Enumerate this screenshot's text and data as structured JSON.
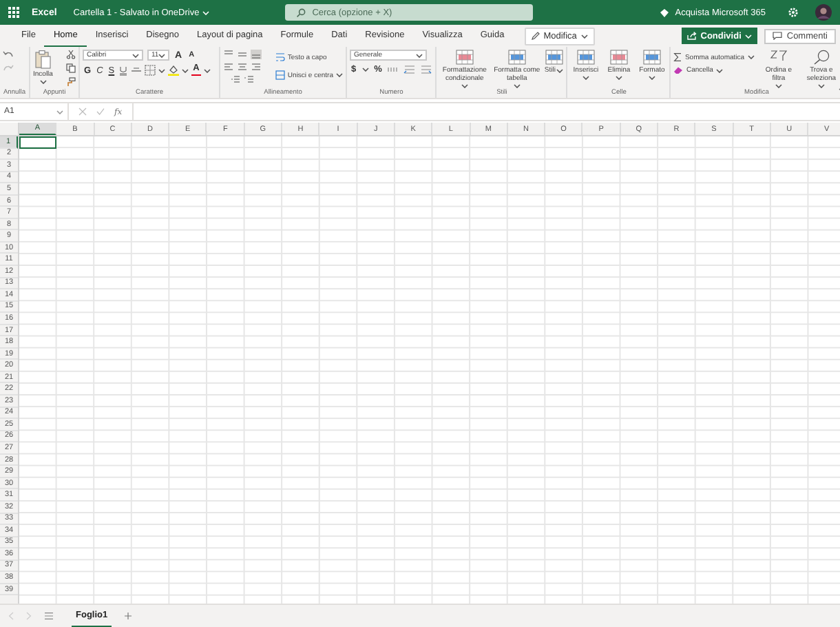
{
  "title_bar": {
    "app": "Excel",
    "document": "Cartella 1 - Salvato in OneDrive",
    "search_placeholder": "Cerca (opzione + X)",
    "buy": "Acquista Microsoft 365"
  },
  "tabs": [
    {
      "label": "File",
      "selected": false
    },
    {
      "label": "Home",
      "selected": true
    },
    {
      "label": "Inserisci",
      "selected": false
    },
    {
      "label": "Disegno",
      "selected": false
    },
    {
      "label": "Layout di pagina",
      "selected": false
    },
    {
      "label": "Formule",
      "selected": false
    },
    {
      "label": "Dati",
      "selected": false
    },
    {
      "label": "Revisione",
      "selected": false
    },
    {
      "label": "Visualizza",
      "selected": false
    },
    {
      "label": "Guida",
      "selected": false
    }
  ],
  "mode_button": "Modifica",
  "share_button": "Condividi",
  "comments_button": "Commenti",
  "ribbon": [
    {
      "kind": "undo",
      "label": "Annulla"
    },
    {
      "kind": "clipboard",
      "label": "Appunti",
      "paste": "Incolla"
    },
    {
      "kind": "font",
      "label": "Carattere",
      "font": "Calibri",
      "size": "11",
      "grow": "A",
      "shrink": "A",
      "bold": "G",
      "italic": "C",
      "underline": "S",
      "font_color": "A"
    },
    {
      "kind": "alignment",
      "label": "Allineamento",
      "wrap": "Testo a capo",
      "merge": "Unisci e centra"
    },
    {
      "kind": "number",
      "label": "Numero",
      "format": "Generale",
      "currency": "$",
      "percent": "%"
    },
    {
      "kind": "big",
      "label": "Stili",
      "buttons": [
        "Formattazione condizionale",
        "Formatta come tabella",
        "Stili"
      ]
    },
    {
      "kind": "big",
      "label": "Celle",
      "buttons": [
        "Inserisci",
        "Elimina",
        "Formato"
      ]
    },
    {
      "kind": "editing",
      "label": "Modifica",
      "autosum": "Somma automatica",
      "clear": "Cancella",
      "buttons": [
        "Ordina e filtra",
        "Trova e seleziona"
      ]
    }
  ],
  "name_box": "A1",
  "fx": "fx",
  "columns": [
    {
      "label": "A",
      "selected": true
    },
    {
      "label": "B",
      "selected": false
    },
    {
      "label": "C",
      "selected": false
    },
    {
      "label": "D",
      "selected": false
    },
    {
      "label": "E",
      "selected": false
    },
    {
      "label": "F",
      "selected": false
    },
    {
      "label": "G",
      "selected": false
    },
    {
      "label": "H",
      "selected": false
    },
    {
      "label": "I",
      "selected": false
    },
    {
      "label": "J",
      "selected": false
    },
    {
      "label": "K",
      "selected": false
    },
    {
      "label": "L",
      "selected": false
    },
    {
      "label": "M",
      "selected": false
    },
    {
      "label": "N",
      "selected": false
    },
    {
      "label": "O",
      "selected": false
    },
    {
      "label": "P",
      "selected": false
    },
    {
      "label": "Q",
      "selected": false
    },
    {
      "label": "R",
      "selected": false
    },
    {
      "label": "S",
      "selected": false
    },
    {
      "label": "T",
      "selected": false
    },
    {
      "label": "U",
      "selected": false
    },
    {
      "label": "V",
      "selected": false
    }
  ],
  "rows": [
    {
      "label": "1",
      "selected": true
    },
    {
      "label": "2",
      "selected": false
    },
    {
      "label": "3",
      "selected": false
    },
    {
      "label": "4",
      "selected": false
    },
    {
      "label": "5",
      "selected": false
    },
    {
      "label": "6",
      "selected": false
    },
    {
      "label": "7",
      "selected": false
    },
    {
      "label": "8",
      "selected": false
    },
    {
      "label": "9",
      "selected": false
    },
    {
      "label": "10",
      "selected": false
    },
    {
      "label": "11",
      "selected": false
    },
    {
      "label": "12",
      "selected": false
    },
    {
      "label": "13",
      "selected": false
    },
    {
      "label": "14",
      "selected": false
    },
    {
      "label": "15",
      "selected": false
    },
    {
      "label": "16",
      "selected": false
    },
    {
      "label": "17",
      "selected": false
    },
    {
      "label": "18",
      "selected": false
    },
    {
      "label": "19",
      "selected": false
    },
    {
      "label": "20",
      "selected": false
    },
    {
      "label": "21",
      "selected": false
    },
    {
      "label": "22",
      "selected": false
    },
    {
      "label": "23",
      "selected": false
    },
    {
      "label": "24",
      "selected": false
    },
    {
      "label": "25",
      "selected": false
    },
    {
      "label": "26",
      "selected": false
    },
    {
      "label": "27",
      "selected": false
    },
    {
      "label": "28",
      "selected": false
    },
    {
      "label": "29",
      "selected": false
    },
    {
      "label": "30",
      "selected": false
    },
    {
      "label": "31",
      "selected": false
    },
    {
      "label": "32",
      "selected": false
    },
    {
      "label": "33",
      "selected": false
    },
    {
      "label": "34",
      "selected": false
    },
    {
      "label": "35",
      "selected": false
    },
    {
      "label": "36",
      "selected": false
    },
    {
      "label": "37",
      "selected": false
    },
    {
      "label": "38",
      "selected": false
    },
    {
      "label": "39",
      "selected": false
    }
  ],
  "sheets": [
    {
      "label": "Foglio1",
      "selected": true
    }
  ]
}
